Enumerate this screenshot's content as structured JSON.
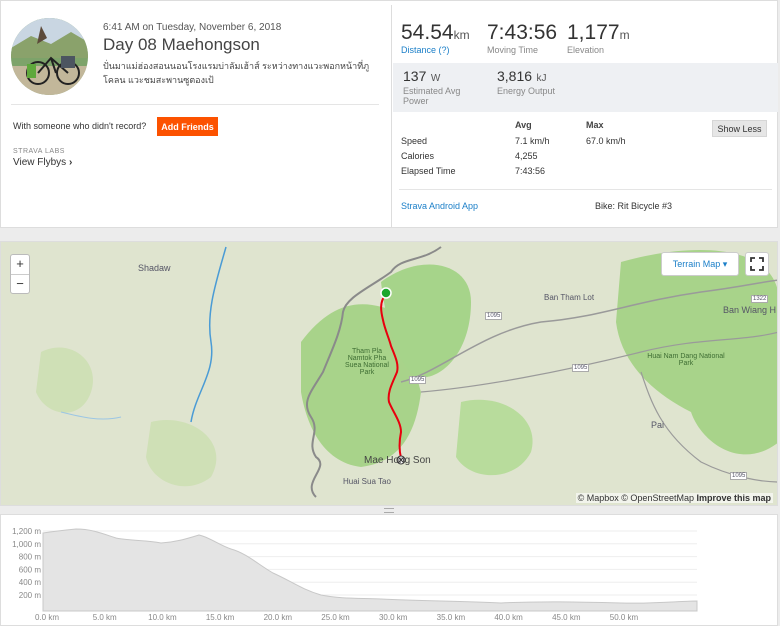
{
  "activity": {
    "meta_time": "6:41 AM on Tuesday, November 6, 2018",
    "title": "Day 08 Maehongson",
    "description": "ปั่นมาแม่ฮ่องสอนนอนโรงแรมบ่าลัมเฮ้าส์ ระหว่างทางแวะพอกหน้าที่ภูโคลน แวะชมสะพานซูตองเป้",
    "with_someone": "With someone who didn't record?",
    "add_friends": "Add Friends",
    "labs": "STRAVA LABS",
    "flybys": "View Flybys"
  },
  "stats": {
    "distance": {
      "value": "54.54",
      "unit": "km",
      "label": "Distance (?)"
    },
    "moving_time": {
      "value": "7:43:56",
      "label": "Moving Time"
    },
    "elevation": {
      "value": "1,177",
      "unit": "m",
      "label": "Elevation"
    },
    "power": {
      "value": "137",
      "unit": "W",
      "label": "Estimated Avg Power"
    },
    "energy": {
      "value": "3,816",
      "unit": "kJ",
      "label": "Energy Output"
    }
  },
  "table": {
    "col_avg": "Avg",
    "col_max": "Max",
    "show_less": "Show Less",
    "rows": [
      {
        "label": "Speed",
        "avg": "7.1 km/h",
        "max": "67.0 km/h"
      },
      {
        "label": "Calories",
        "avg": "4,255",
        "max": ""
      },
      {
        "label": "Elapsed Time",
        "avg": "7:43:56",
        "max": ""
      }
    ],
    "app": "Strava Android App",
    "bike": "Bike: Rit Bicycle #3"
  },
  "map": {
    "terrain_label": "Terrain Map",
    "zoom_in": "+",
    "zoom_out": "−",
    "attribution_a": "© Mapbox © OpenStreetMap ",
    "attribution_b": "Improve this map",
    "places": {
      "shadaw": "Shadaw",
      "ban_tham_lot": "Ban Tham Lot",
      "ban_wiang_h": "Ban Wiang H",
      "huai_nam_dang": "Huai Nam Dang National Park",
      "tham_pla": "Tham Pla Namtok Pha Suea National Park",
      "pai": "Pai",
      "mae_hong_son": "Mae Hong Son",
      "huai_sua_tao": "Huai Sua Tao",
      "road_1095a": "1095",
      "road_1095b": "1095",
      "road_1095c": "1095",
      "road_1095d": "1095",
      "road_1322": "1322"
    },
    "colors": {
      "route": "#e8000e",
      "start": "#1ba72d",
      "terrain": "#dfe4cf",
      "forest": "#a8d38a",
      "river": "#4a9bd5"
    }
  },
  "elevation_profile": {
    "y_ticks": [
      "200 m",
      "400 m",
      "600 m",
      "800 m",
      "1,000 m",
      "1,200 m"
    ],
    "x_ticks": [
      "0.0 km",
      "5.0 km",
      "10.0 km",
      "15.0 km",
      "20.0 km",
      "25.0 km",
      "30.0 km",
      "35.0 km",
      "40.0 km",
      "45.0 km",
      "50.0 km"
    ],
    "fill_color": "#e4e4e4",
    "line_color": "#c8c8c8"
  }
}
